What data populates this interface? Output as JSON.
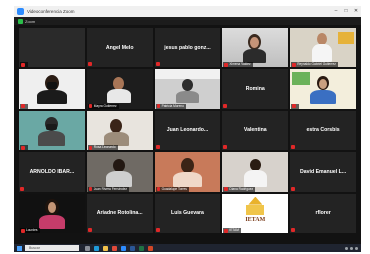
{
  "window": {
    "title": "Videoconferencia Zoom"
  },
  "infobar": {
    "label": "Zoom"
  },
  "participants": [
    {
      "name": "",
      "video": true
    },
    {
      "name": "Angel Melo",
      "video": false
    },
    {
      "name": "jesus pablo gonz...",
      "video": false
    },
    {
      "name": "Ximena Valdez",
      "video": true
    },
    {
      "name": "Reynaldo Gabriel Gutierrez",
      "video": true
    },
    {
      "name": "",
      "video": true
    },
    {
      "name": "Mayra Gutierrez",
      "video": true
    },
    {
      "name": "Patricia Moreno",
      "video": true
    },
    {
      "name": "Romina",
      "video": false
    },
    {
      "name": "",
      "video": true,
      "active": true
    },
    {
      "name": "",
      "video": true
    },
    {
      "name": "Rosa Leonardo",
      "video": true
    },
    {
      "name": "Juan Leonardo...",
      "video": false
    },
    {
      "name": "Valentina",
      "video": false
    },
    {
      "name": "estra Corsbis",
      "video": false
    },
    {
      "name": "ARNOLDO IBAR...",
      "video": false
    },
    {
      "name": "Juan Rivera Fernández",
      "video": true
    },
    {
      "name": "Guadalupe Torres",
      "video": true
    },
    {
      "name": "Diana Rodriguez",
      "video": true
    },
    {
      "name": "David Emanuel L...",
      "video": false
    },
    {
      "name": "Lourdes",
      "video": true
    },
    {
      "name": "Ariadne Rotolina...",
      "video": false
    },
    {
      "name": "Luis Guevara",
      "video": false
    },
    {
      "name": "IETAM",
      "video": true,
      "logo": "IETAM"
    },
    {
      "name": "rflorer",
      "video": false
    }
  ],
  "taskbar": {
    "search_placeholder": "Buscar"
  },
  "colors": {
    "zoom_blue": "#2d8cff",
    "active_border": "#f1d64a",
    "mic_muted": "#e02828"
  }
}
